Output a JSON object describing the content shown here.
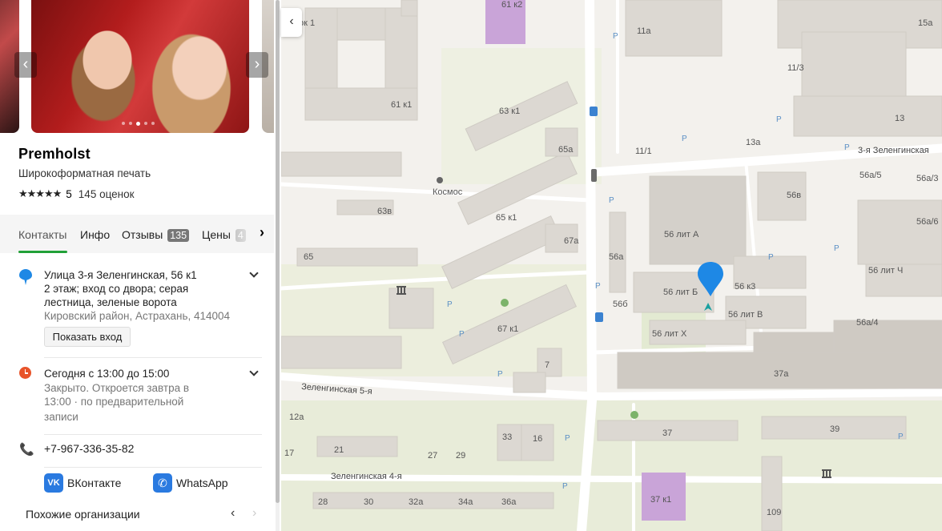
{
  "org": {
    "name": "Premholst",
    "category": "Широкоформатная печать",
    "stars": "★★★★★",
    "rating": "5",
    "reviews_count": "145 оценок"
  },
  "tabs": [
    {
      "label": "Контакты",
      "badge": ""
    },
    {
      "label": "Инфо",
      "badge": ""
    },
    {
      "label": "Отзывы",
      "badge": "135"
    },
    {
      "label": "Цены",
      "badge": "4"
    }
  ],
  "contacts": {
    "address": "Улица 3-я Зеленгинская, 56 к1",
    "address_detail_1": "2 этаж; вход со двора; серая",
    "address_detail_2": "лестница, зеленые ворота",
    "district": "Кировский район, Астрахань, 414004",
    "show_entrance": "Показать вход",
    "hours": "Сегодня с 13:00 до 15:00",
    "hours_status_1": "Закрыто. Откроется завтра в",
    "hours_status_2": "13:00 · по предварительной",
    "hours_status_3": "записи",
    "phone": "+7-967-336-35-82",
    "vk": "ВКонтакте",
    "whatsapp": "WhatsApp"
  },
  "similar": "Похожие организации",
  "map": {
    "accent": "#1e88e5",
    "streets": [
      "3-я Зеленгинская",
      "Зеленгинская 5-я",
      "Зеленгинская 4-я"
    ],
    "poi": [
      "Космос"
    ],
    "buildings": [
      "61 к2",
      "11а",
      "15а",
      "ок 1",
      "61 к1",
      "63 к1",
      "11/3",
      "13",
      "65а",
      "11/1",
      "13а",
      "56а/5",
      "56а/3",
      "56в",
      "63в",
      "65 к1",
      "67а",
      "56 лит А",
      "56а/6",
      "65",
      "56а",
      "56 лит Б",
      "56 к3",
      "56 лит Ч",
      "56б",
      "56 лит В",
      "67 к1",
      "56 лит Х",
      "56а/4",
      "7",
      "37а",
      "12а",
      "21",
      "33",
      "16",
      "37",
      "39",
      "17",
      "27",
      "29",
      "28",
      "30",
      "32а",
      "34а",
      "36а",
      "37 к1",
      "109"
    ]
  }
}
